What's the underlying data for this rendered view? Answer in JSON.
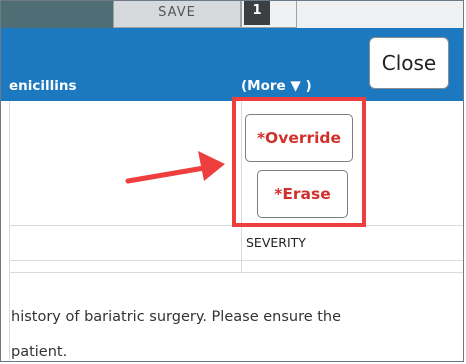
{
  "toolbar": {
    "save_label": "SAVE",
    "count": "1"
  },
  "header": {
    "allergy_label": "enicillins",
    "more_label": "(More ▼ )",
    "close_label": "Close"
  },
  "actions": {
    "override_label": "*Override",
    "erase_label": "*Erase"
  },
  "table": {
    "severity_header": "SEVERITY"
  },
  "notes": {
    "line1": "history of bariatric surgery. Please ensure the",
    "line2": "patient."
  },
  "colors": {
    "header_blue": "#1c79c0",
    "action_red": "#d0312d",
    "highlight_red": "#ee3e3e"
  }
}
